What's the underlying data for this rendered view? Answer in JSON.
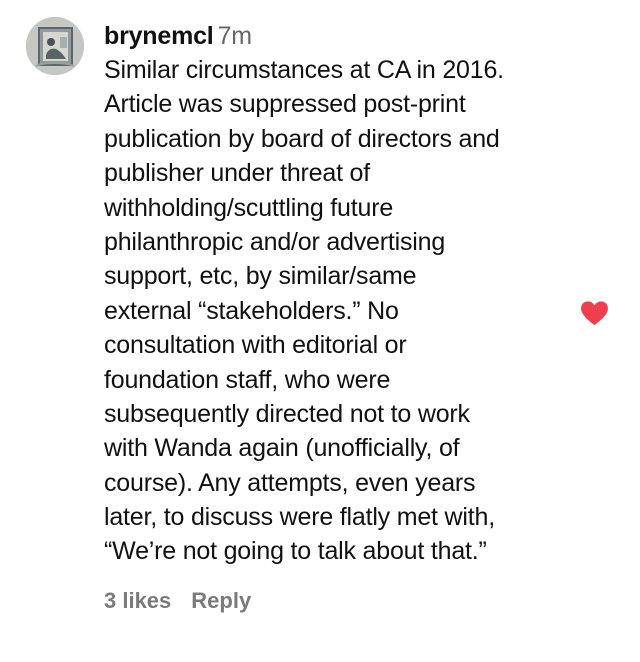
{
  "comment": {
    "username": "brynemcl",
    "timestamp": "7m",
    "lines": [
      "Similar circumstances at CA in 2016.",
      "Article was suppressed post-print",
      "publication by board of directors and",
      "publisher under threat of",
      "withholding/scuttling future",
      "philanthropic and/or advertising",
      "support, etc, by similar/same",
      "external “stakeholders.” No",
      "consultation with editorial or",
      "foundation staff, who were",
      "subsequently directed not to work",
      "with Wanda again (unofficially, of",
      "course). Any attempts, even years",
      "later, to discuss were flatly met with,",
      "“We’re not going to talk about that.”"
    ],
    "likes_label": "3 likes",
    "reply_label": "Reply",
    "liked": true,
    "icons": {
      "avatar": "profile-photo",
      "like": "heart-icon"
    },
    "colors": {
      "heart": "#ed3f4e",
      "username": "#111111",
      "timestamp": "#666666",
      "actions": "#7a7a7a"
    }
  }
}
